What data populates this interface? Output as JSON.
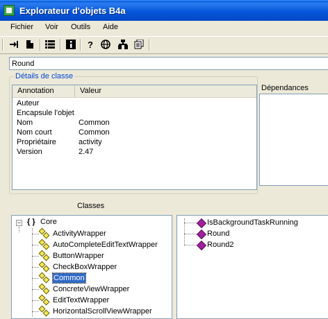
{
  "window": {
    "title": "Explorateur d'objets B4a"
  },
  "menu": {
    "items": [
      "Fichier",
      "Voir",
      "Outils",
      "Aide"
    ]
  },
  "toolbar": {
    "icons": [
      "import-icon",
      "new-document-icon",
      "list-icon",
      "info-icon",
      "help-icon",
      "globe-icon",
      "network-icon",
      "copy-icon"
    ]
  },
  "search": {
    "value": "Round"
  },
  "details": {
    "legend": "Détails de classe",
    "col_annotation": "Annotation",
    "col_value": "Valeur",
    "rows": [
      {
        "key": "Auteur",
        "value": ""
      },
      {
        "key": "Encapsule l'objet",
        "value": ""
      },
      {
        "key": "Nom",
        "value": "Common"
      },
      {
        "key": "Nom court",
        "value": "Common"
      },
      {
        "key": "Propriétaire",
        "value": "activity"
      },
      {
        "key": "Version",
        "value": "2.47"
      }
    ]
  },
  "dependencies": {
    "label": "Dépendances"
  },
  "classes": {
    "label": "Classes",
    "root": "Core",
    "items": [
      "ActivityWrapper",
      "AutoCompleteEditTextWrapper",
      "ButtonWrapper",
      "CheckBoxWrapper",
      "Common",
      "ConcreteViewWrapper",
      "EditTextWrapper",
      "HorizontalScrollViewWrapper"
    ],
    "selected": "Common"
  },
  "members": {
    "items": [
      "IsBackgroundTaskRunning",
      "Round",
      "Round2"
    ]
  }
}
